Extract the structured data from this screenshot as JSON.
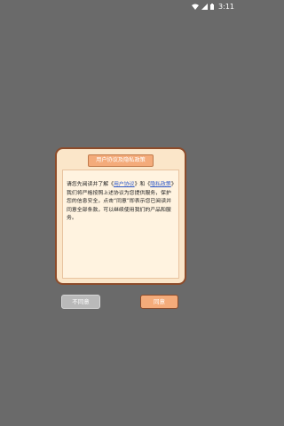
{
  "status_bar": {
    "time": "3:11",
    "icons": [
      "wifi-icon",
      "signal-icon",
      "battery-icon"
    ]
  },
  "dialog": {
    "title": "用户协议及隐私政策",
    "body": {
      "text1": "请您先阅读并了解《",
      "link_user_agreement": "用户协议",
      "text2": "》和《",
      "link_privacy_policy": "隐私政策",
      "text3": "》我们将严格按照上述协议为您提供服务，保护您的信息安全，点击“同意”即表示您已阅读并同意全部条款，可以继续使用我们的产品和服务。"
    }
  },
  "buttons": {
    "disagree_label": "不同意",
    "agree_label": "同意"
  },
  "colors": {
    "background": "#6a6a6a",
    "dialog_fill": "#fbe6c9",
    "dialog_border": "#8c4b2a",
    "title_fill": "#f4ab7a",
    "link": "#2c57c9",
    "agree_fill": "#f4ab7a",
    "disagree_fill": "#b9b9b9"
  }
}
